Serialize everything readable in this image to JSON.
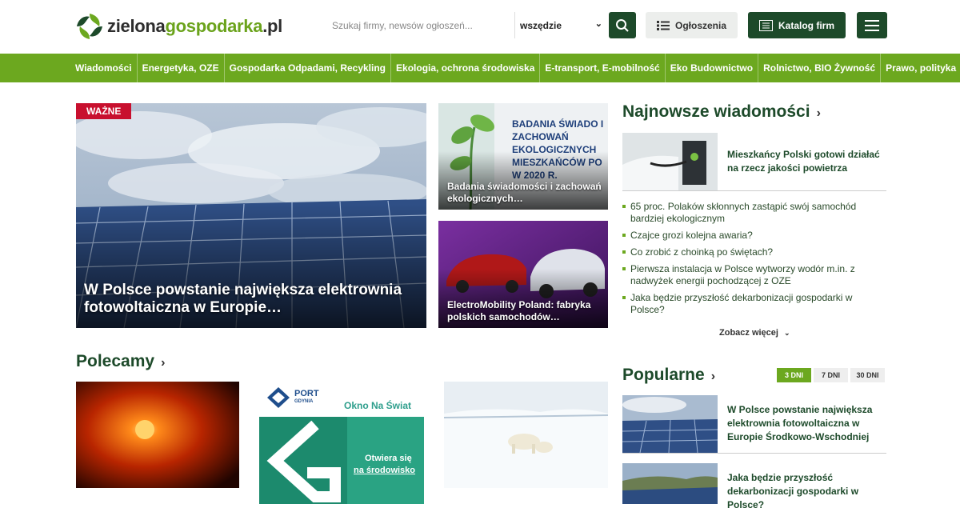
{
  "site": {
    "name_part1": "zielona",
    "name_part2": "gospodarka",
    "name_part3": ".pl"
  },
  "header": {
    "search_placeholder": "Szukaj firmy, newsów ogłoszeń...",
    "scope": "wszędzie",
    "ads_label": "Ogłoszenia",
    "catalog_label": "Katalog firm"
  },
  "nav": [
    "Wiadomości",
    "Energetyka, OZE",
    "Gospodarka Odpadami, Recykling",
    "Ekologia, ochrona środowiska",
    "E-transport, E-mobilność",
    "Eko Budownictwo",
    "Rolnictwo, BIO Żywność",
    "Prawo, polityka"
  ],
  "hero": {
    "badge": "WAŻNE",
    "title": "W Polsce powstanie największa elektrownia fotowoltaiczna w Europie…"
  },
  "card1": {
    "title": "Badania świadomości i zachowań ekologicznych…",
    "img_text": "BADANIA ŚWIADO I ZACHOWAŃ EKOLOGICZNYCH MIESZKAŃCÓW PO W 2020 R."
  },
  "card2": {
    "title": "ElectroMobility Poland: fabryka polskich samochodów…"
  },
  "latest": {
    "heading": "Najnowsze wiadomości",
    "lead": "Mieszkańcy Polski gotowi działać na rzecz jakości powietrza",
    "items": [
      "65 proc. Polaków skłonnych zastąpić swój samochód bardziej ekologicznym",
      "Czajce grozi kolejna awaria?",
      "Co zrobić z choinką po świętach?",
      "Pierwsza instalacja w Polsce wytworzy wodór m.in. z nadwyżek energii pochodzącej z OZE",
      "Jaka będzie przyszłość dekarbonizacji gospodarki w Polsce?"
    ],
    "more": "Zobacz więcej"
  },
  "recommended": {
    "heading": "Polecamy",
    "port_name": "PORT",
    "port_sub": "GDYNIA",
    "port_slogan": "Okno Na Świat",
    "port_cta1": "Otwiera się",
    "port_cta2": "na środowisko"
  },
  "popular": {
    "heading": "Popularne",
    "tabs": [
      "3 DNI",
      "7 DNI",
      "30 DNI"
    ],
    "items": [
      "W Polsce powstanie największa elektrownia fotowoltaiczna w Europie Środkowo-Wschodniej",
      "Jaka będzie przyszłość dekarbonizacji gospodarki w Polsce?"
    ]
  },
  "colors": {
    "brand_dark": "#1d4a2a",
    "brand_green": "#6ca81f",
    "badge_red": "#c8102e"
  }
}
